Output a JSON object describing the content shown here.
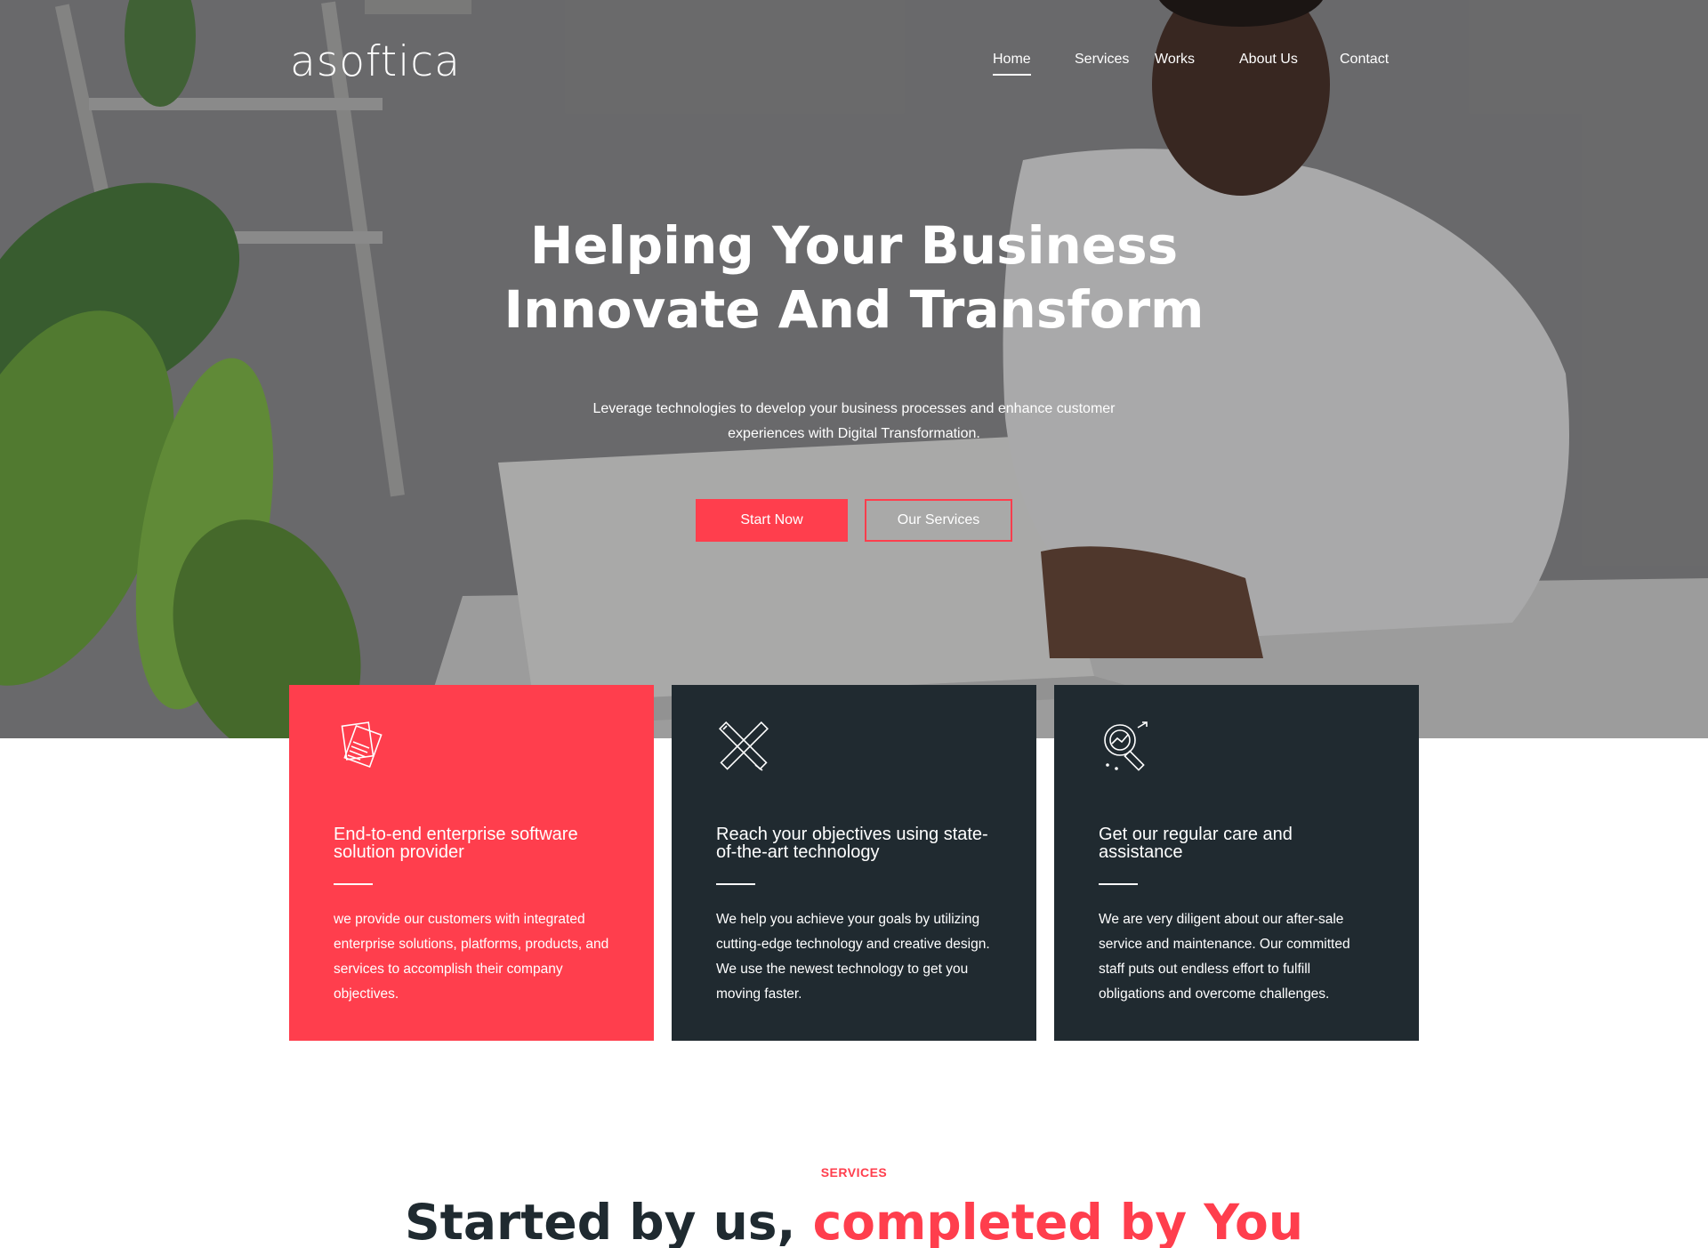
{
  "brand": {
    "logo": "asoftica"
  },
  "nav": {
    "items": [
      {
        "label": "Home",
        "active": true
      },
      {
        "label": "Services",
        "active": false
      },
      {
        "label": "Works",
        "active": false
      },
      {
        "label": "About Us",
        "active": false
      },
      {
        "label": "Contact",
        "active": false
      }
    ]
  },
  "hero": {
    "title_line1": "Helping Your Business",
    "title_line2": "Innovate And Transform",
    "subtitle_line1": "Leverage technologies to develop your business processes and enhance customer",
    "subtitle_line2": "experiences with Digital Transformation.",
    "primary_button": "Start Now",
    "secondary_button": "Our Services"
  },
  "cards": [
    {
      "icon": "documents-icon",
      "title_line1": "End-to-end enterprise software",
      "title_line2": "solution provider",
      "text": "we provide our customers with integrated enterprise solutions, platforms, products, and services to accomplish their company objectives."
    },
    {
      "icon": "pencil-ruler-icon",
      "title_line1": "Reach your objectives using state-",
      "title_line2": "of-the-art technology",
      "text": "We help you achieve your goals by utilizing cutting-edge technology and creative design. We use the newest technology to get you moving faster."
    },
    {
      "icon": "magnifier-analytics-icon",
      "title_line1": "Get our regular care and",
      "title_line2": "assistance",
      "text": "We are very diligent about our after-sale service and maintenance. Our committed staff puts out endless effort to fulfill obligations and overcome challenges."
    }
  ],
  "services": {
    "label": "SERVICES",
    "title_part1": "Started by us, ",
    "title_part2": "completed by You"
  },
  "colors": {
    "accent": "#ff3e4d",
    "dark": "#202a30"
  }
}
